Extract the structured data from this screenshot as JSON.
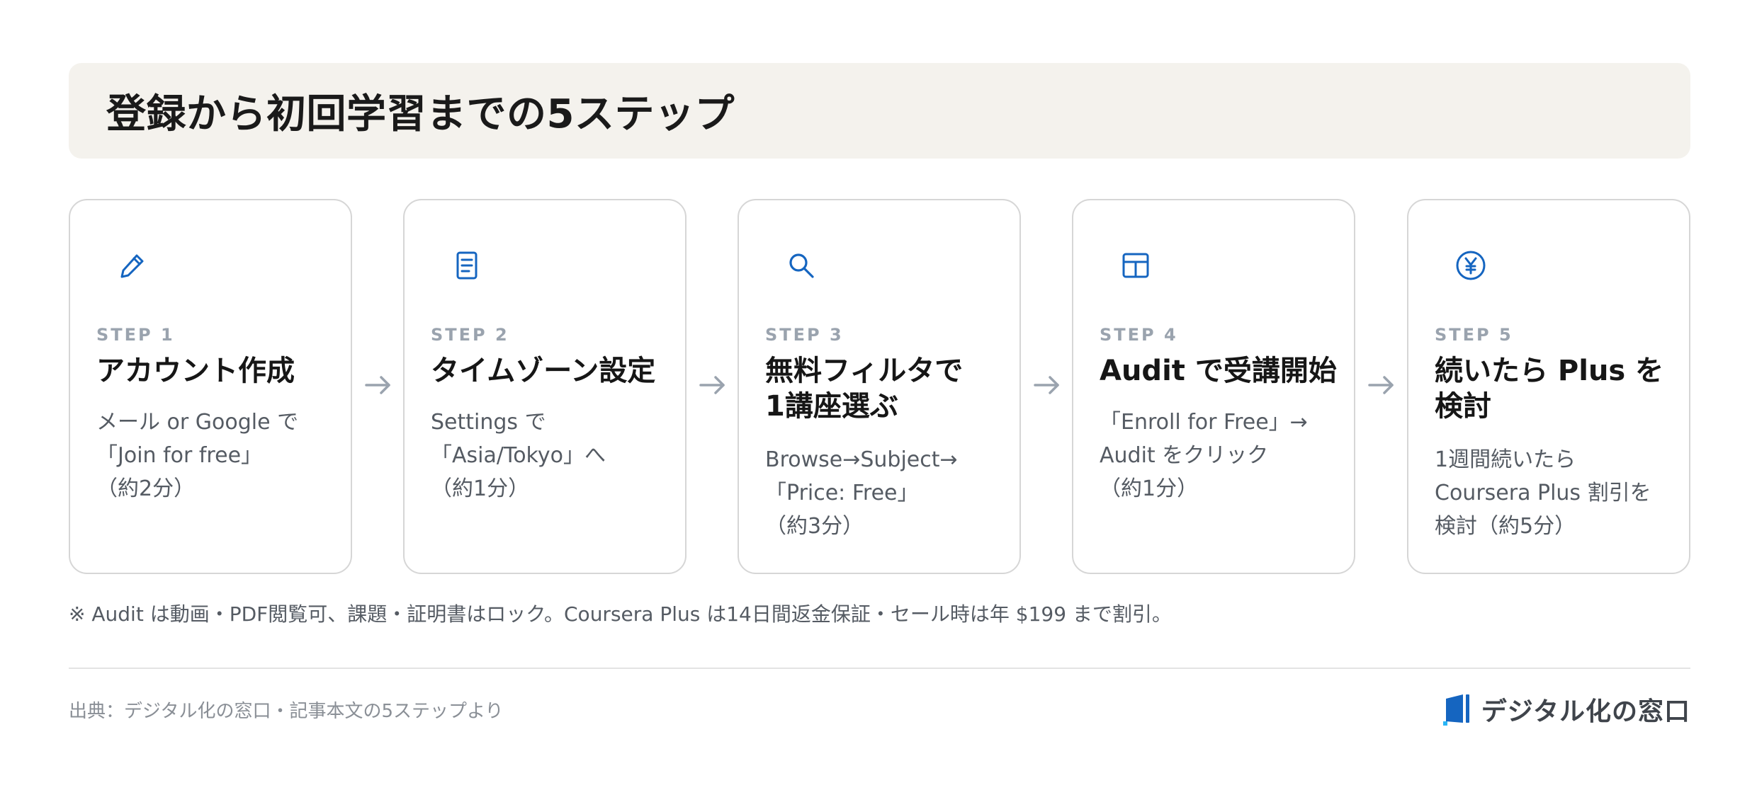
{
  "header": {
    "title": "登録から初回学習までの5ステップ"
  },
  "steps": [
    {
      "icon": "pencil-icon",
      "label": "STEP 1",
      "title": "アカウント作成",
      "description": "メール or Google で\n「Join for free」\n（約2分）"
    },
    {
      "icon": "document-icon",
      "label": "STEP 2",
      "title": "タイムゾーン設定",
      "description": "Settings で\n「Asia/Tokyo」へ\n（約1分）"
    },
    {
      "icon": "search-icon",
      "label": "STEP 3",
      "title": "無料フィルタで\n1講座選ぶ",
      "description": "Browse→Subject→\n「Price: Free」\n（約3分）"
    },
    {
      "icon": "layout-grid-icon",
      "label": "STEP 4",
      "title": "Audit で受講開始",
      "description": "「Enroll for Free」→\nAudit をクリック\n（約1分）"
    },
    {
      "icon": "yen-icon",
      "label": "STEP 5",
      "title": "続いたら Plus を\n検討",
      "description": "1週間続いたら\nCoursera Plus 割引を\n検討（約5分）"
    }
  ],
  "note": "※ Audit は動画・PDF閲覧可、課題・証明書はロック。Coursera Plus は14日間返金保証・セール時は年 $199 まで割引。",
  "footer": {
    "source": "出典：デジタル化の窓口・記事本文の5ステップより",
    "brand": "デジタル化の窓口"
  },
  "colors": {
    "accent": "#1565c0",
    "title_bg": "#f4f2ed",
    "card_border": "#d6d6d6",
    "step_label": "#9aa3ae",
    "arrow": "#9aa3ae"
  }
}
